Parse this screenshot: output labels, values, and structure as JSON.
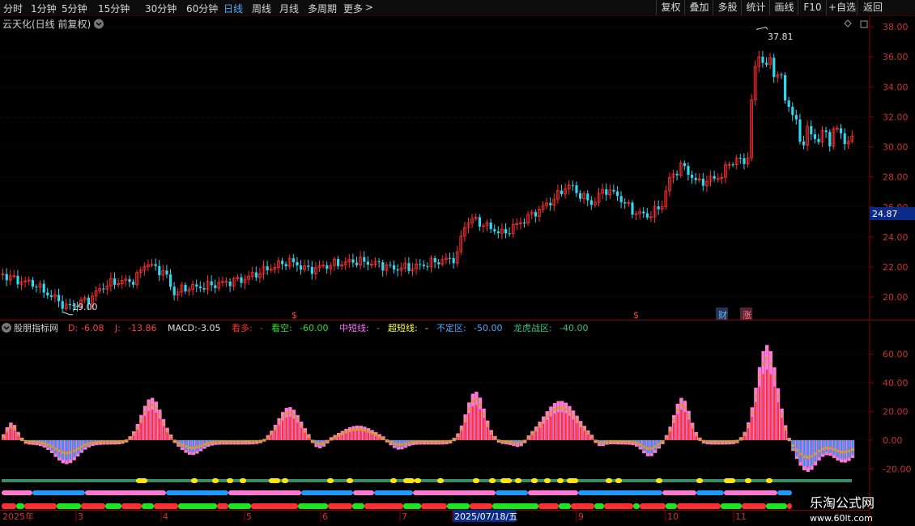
{
  "toolbar": {
    "tabs": [
      "分时",
      "1分钟",
      "5分钟",
      "15分钟",
      "30分钟",
      "60分钟",
      "日线",
      "周线",
      "月线",
      "多周期",
      "更多"
    ],
    "active_tab": "日线",
    "more_arrow": ">",
    "right_buttons": [
      "复权",
      "叠加",
      "多股",
      "统计",
      "画线",
      "F10",
      "+自选",
      "返回"
    ]
  },
  "price_panel": {
    "title": "云天化(日线 前复权)",
    "high_label": "37.81",
    "low_label": "19.00",
    "current_price": "24.87",
    "y_ticks": [
      "38.00",
      "36.00",
      "34.00",
      "32.00",
      "30.00",
      "28.00",
      "26.00",
      "24.00",
      "22.00",
      "20.00"
    ],
    "markers": [
      "$",
      "$",
      "财",
      "涨"
    ]
  },
  "indicator_panel": {
    "name": "股朋指标网",
    "values": [
      {
        "label": "D:",
        "value": "-6.08",
        "color": "#ff4040"
      },
      {
        "label": "J:",
        "value": "-13.86",
        "color": "#ff4040"
      },
      {
        "label": "MACD:",
        "value": "-3.05",
        "color": "#e0e0e0"
      },
      {
        "label": "看多:",
        "value": "-",
        "color": "#ff3030"
      },
      {
        "label": "看空:",
        "value": "-60.00",
        "color": "#30e030"
      },
      {
        "label": "中短线:",
        "value": "-",
        "color": "#ff70ff"
      },
      {
        "label": "超短线:",
        "value": "-",
        "color": "#ffff40"
      },
      {
        "label": "不定区:",
        "value": "-50.00",
        "color": "#4aa8ff"
      },
      {
        "label": "龙虎战区:",
        "value": "-40.00",
        "color": "#3cc080"
      }
    ],
    "y_ticks": [
      "60.00",
      "40.00",
      "20.00",
      "0.00",
      "-20.00"
    ]
  },
  "time_axis": {
    "labels": [
      "2025年",
      "3",
      "4",
      "5",
      "6",
      "7",
      "2025/07/18/五",
      "9",
      "10",
      "11"
    ]
  },
  "watermark": {
    "title": "乐淘公式网",
    "url": "www.60lt.com"
  },
  "chart_data": {
    "type": "candlestick",
    "price_range": [
      18.5,
      38.7
    ],
    "high": 37.81,
    "low": 19.0,
    "current": 24.87,
    "indicator_range": [
      -26,
      80
    ],
    "colors": {
      "up": "#ff3030",
      "down": "#33d6f0",
      "pink": "#ff78d2",
      "gold": "#d89a38",
      "blue": "#1f9bff",
      "green": "#1ee61e",
      "yellow": "#ffe600",
      "teal": "#3a8c66"
    }
  }
}
